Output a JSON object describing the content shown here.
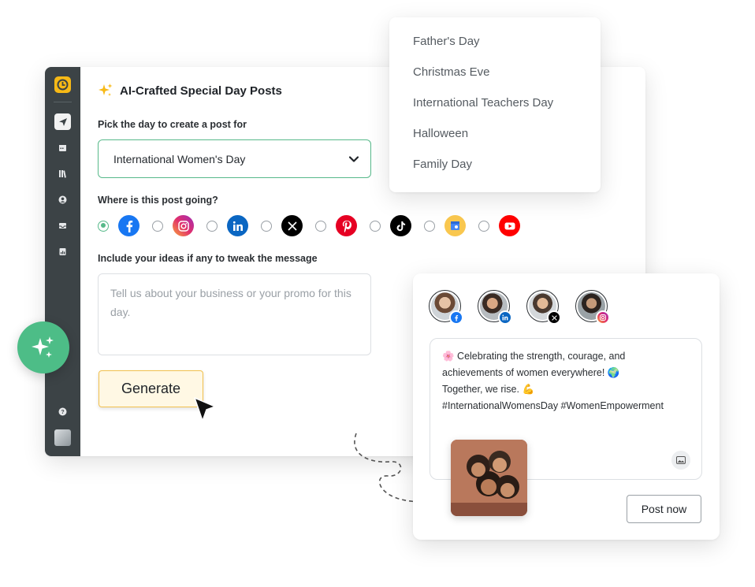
{
  "composer": {
    "title": "AI-Crafted Special Day Posts",
    "day_label": "Pick the day to create a post for",
    "selected_day": "International Women's Day",
    "destination_label": "Where is this post going?",
    "ideas_label": "Include your ideas if any to tweak the message",
    "ideas_placeholder": "Tell us about your business or your promo for this day.",
    "generate_label": "Generate",
    "networks": [
      {
        "name": "facebook",
        "selected": true,
        "color": "#1877f2"
      },
      {
        "name": "instagram",
        "selected": false,
        "color": "#e1306c"
      },
      {
        "name": "linkedin",
        "selected": false,
        "color": "#0a66c2"
      },
      {
        "name": "x",
        "selected": false,
        "color": "#000000"
      },
      {
        "name": "pinterest",
        "selected": false,
        "color": "#e60023"
      },
      {
        "name": "tiktok",
        "selected": false,
        "color": "#000000"
      },
      {
        "name": "google-business",
        "selected": false,
        "color": "#f9c74f"
      },
      {
        "name": "youtube",
        "selected": false,
        "color": "#ff0000"
      }
    ]
  },
  "day_dropdown": {
    "options": [
      "Father's Day",
      "Christmas Eve",
      "International Teachers Day",
      "Halloween",
      "Family Day"
    ]
  },
  "post_preview": {
    "accounts": [
      {
        "network": "facebook",
        "badge_color": "#1877f2"
      },
      {
        "network": "linkedin",
        "badge_color": "#0a66c2"
      },
      {
        "network": "x",
        "badge_color": "#000000"
      },
      {
        "network": "instagram",
        "badge_color": "#e1306c"
      }
    ],
    "lines": [
      "🌸 Celebrating the strength, courage, and",
      "achievements of women everywhere! 🌍",
      "Together, we rise. 💪",
      "#InternationalWomensDay #WomenEmpowerment"
    ],
    "post_now_label": "Post now"
  },
  "colors": {
    "accent_green": "#4dbd87",
    "sidebar": "#3c4346",
    "generate_bg": "#fff8e4",
    "generate_border": "#f2c14e"
  }
}
